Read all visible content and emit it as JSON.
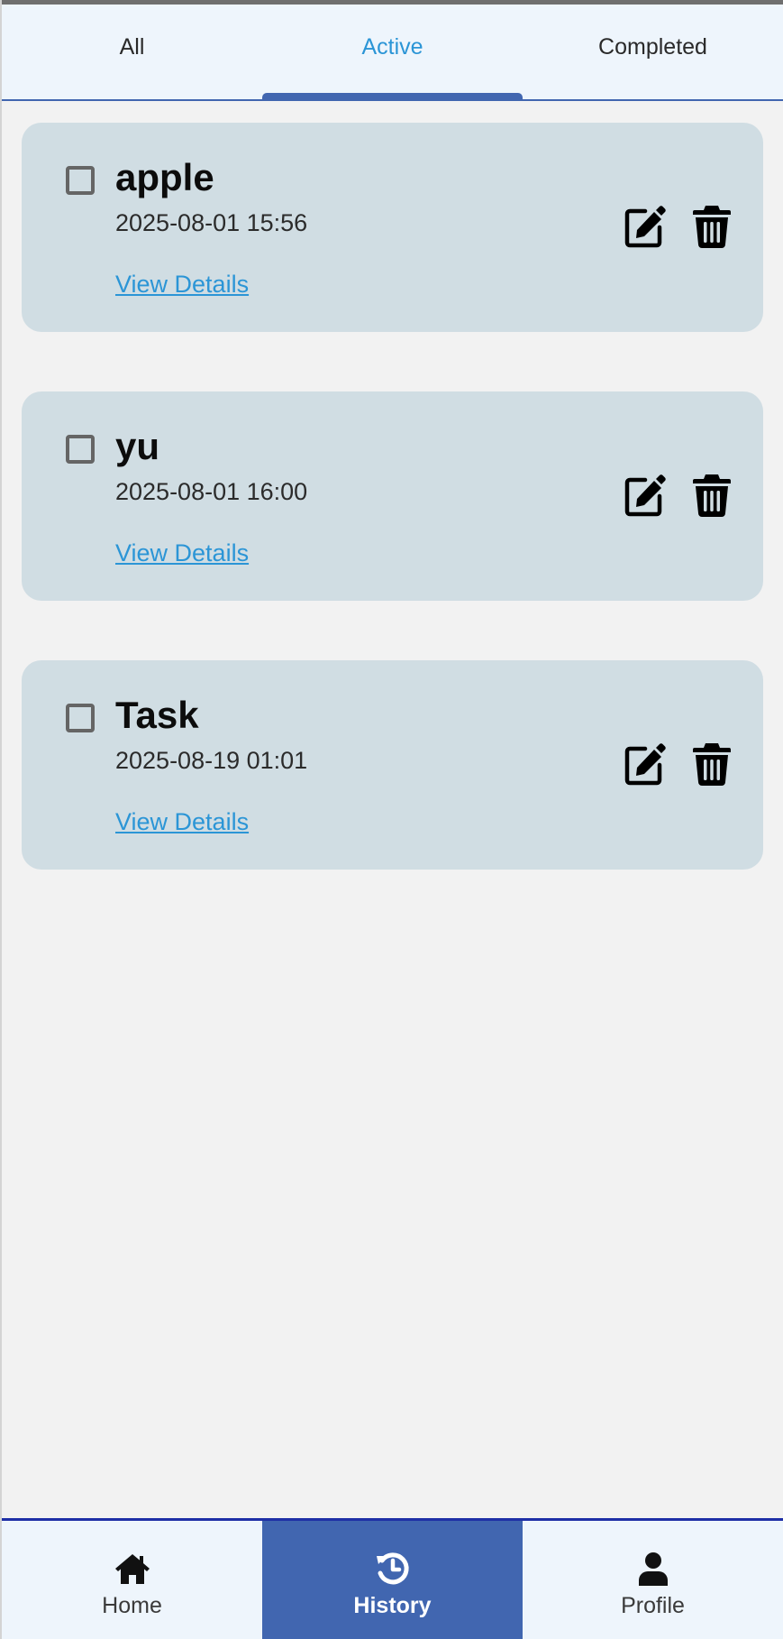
{
  "tabs": [
    {
      "label": "All",
      "active": false
    },
    {
      "label": "Active",
      "active": true
    },
    {
      "label": "Completed",
      "active": false
    }
  ],
  "tasks": [
    {
      "title": "apple",
      "datetime": "2025-08-01 15:56",
      "link_label": "View Details",
      "checked": false
    },
    {
      "title": "yu",
      "datetime": "2025-08-01 16:00",
      "link_label": "View Details",
      "checked": false
    },
    {
      "title": "Task",
      "datetime": "2025-08-19 01:01",
      "link_label": "View Details",
      "checked": false
    }
  ],
  "task_actions": {
    "edit_icon": "edit-icon",
    "delete_icon": "trash-icon"
  },
  "bottom_nav": [
    {
      "label": "Home",
      "icon": "home-icon",
      "active": false
    },
    {
      "label": "History",
      "icon": "history-icon",
      "active": true
    },
    {
      "label": "Profile",
      "icon": "person-icon",
      "active": false
    }
  ],
  "colors": {
    "accent": "#4166b0",
    "link": "#2b95d6",
    "card_bg": "#d0dde3",
    "page_bg": "#f2f2f2",
    "bar_bg": "#eef5fc"
  }
}
